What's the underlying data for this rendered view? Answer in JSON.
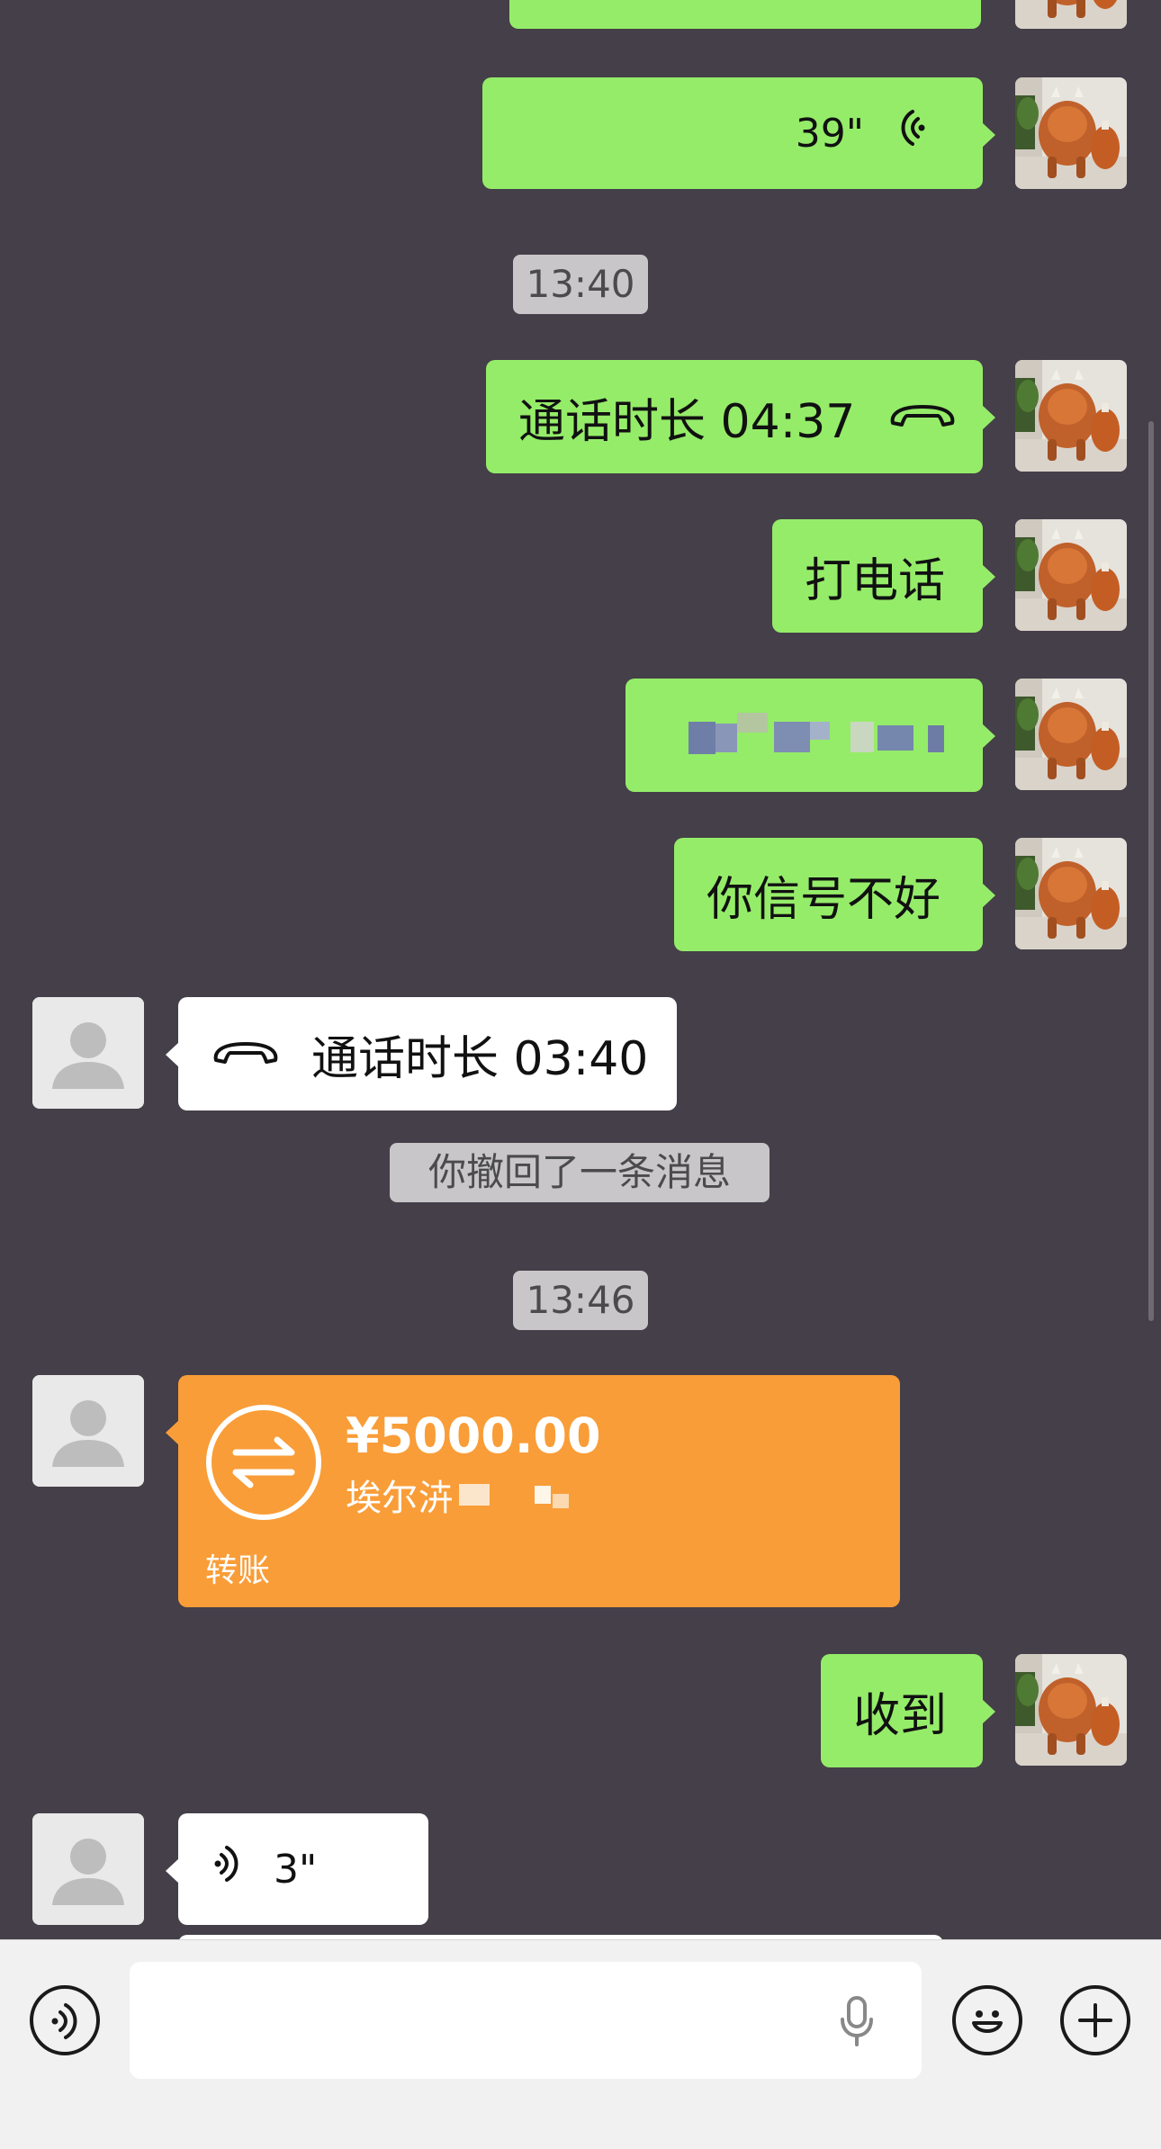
{
  "messages": {
    "voice_mine": {
      "duration": "39\""
    },
    "time_1": "13:40",
    "call_mine": {
      "label": "通话时长 04:37"
    },
    "text_call": "打电话",
    "text_bad_signal": "你信号不好",
    "call_theirs": {
      "label": "通话时长 03:40"
    },
    "recall_notice": "你撤回了一条消息",
    "time_2": "13:46",
    "transfer": {
      "amount": "¥5000.00",
      "recipient": "埃尔泋",
      "footer": "转账"
    },
    "text_received": "收到",
    "voice_theirs": {
      "duration": "3\""
    }
  },
  "colors": {
    "background": "#443f48",
    "my_bubble": "#95ec69",
    "their_bubble": "#ffffff",
    "transfer_bubble": "#f99d38"
  },
  "icons": {
    "voice": "voice-wave-icon",
    "phone": "phone-handset-icon",
    "transfer": "transfer-arrows-icon",
    "mic": "microphone-icon",
    "emoji": "smiley-icon",
    "plus": "plus-icon",
    "voice_toggle": "voice-input-icon"
  }
}
